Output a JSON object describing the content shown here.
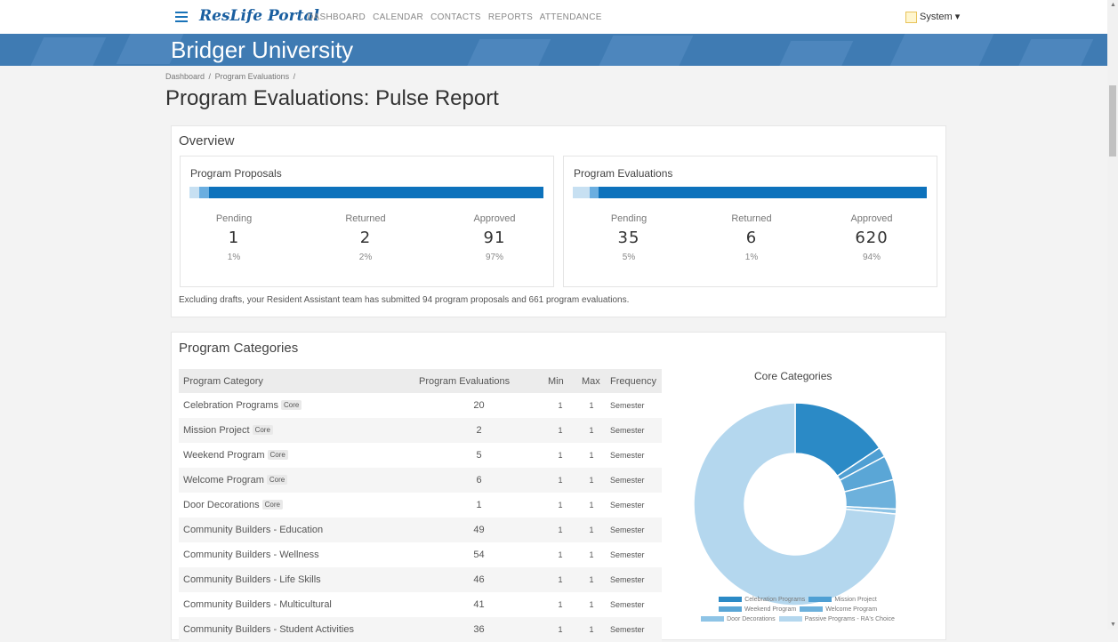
{
  "app": {
    "logo": "ResLife Portal",
    "nav": [
      "DASHBOARD",
      "CALENDAR",
      "CONTACTS",
      "REPORTS",
      "ATTENDANCE"
    ],
    "user": "System ▾",
    "banner_title": "Bridger University"
  },
  "breadcrumb": [
    "Dashboard",
    "/",
    "Program Evaluations",
    "/"
  ],
  "page_title": "Program Evaluations: Pulse Report",
  "overview": {
    "title": "Overview",
    "proposals": {
      "title": "Program Proposals",
      "stats": [
        {
          "label": "Pending",
          "value": "1",
          "pct": "1%",
          "fraction": 0.01
        },
        {
          "label": "Returned",
          "value": "2",
          "pct": "2%",
          "fraction": 0.02
        },
        {
          "label": "Approved",
          "value": "91",
          "pct": "97%",
          "fraction": 0.97
        }
      ]
    },
    "evaluations": {
      "title": "Program Evaluations",
      "stats": [
        {
          "label": "Pending",
          "value": "35",
          "pct": "5%",
          "fraction": 0.05
        },
        {
          "label": "Returned",
          "value": "6",
          "pct": "1%",
          "fraction": 0.01
        },
        {
          "label": "Approved",
          "value": "620",
          "pct": "94%",
          "fraction": 0.94
        }
      ]
    },
    "summary": "Excluding drafts, your Resident Assistant team has submitted 94 program proposals and 661 program evaluations."
  },
  "categories": {
    "title": "Program Categories",
    "columns": [
      "Program Category",
      "Program Evaluations",
      "Min",
      "Max",
      "Frequency"
    ],
    "badge": "Core",
    "rows": [
      {
        "name": "Celebration Programs",
        "core": true,
        "evals": "20",
        "min": "1",
        "max": "1",
        "freq": "Semester"
      },
      {
        "name": "Mission Project",
        "core": true,
        "evals": "2",
        "min": "1",
        "max": "1",
        "freq": "Semester"
      },
      {
        "name": "Weekend Program",
        "core": true,
        "evals": "5",
        "min": "1",
        "max": "1",
        "freq": "Semester"
      },
      {
        "name": "Welcome Program",
        "core": true,
        "evals": "6",
        "min": "1",
        "max": "1",
        "freq": "Semester"
      },
      {
        "name": "Door Decorations",
        "core": true,
        "evals": "1",
        "min": "1",
        "max": "1",
        "freq": "Semester"
      },
      {
        "name": "Community Builders - Education",
        "core": false,
        "evals": "49",
        "min": "1",
        "max": "1",
        "freq": "Semester"
      },
      {
        "name": "Community Builders - Wellness",
        "core": false,
        "evals": "54",
        "min": "1",
        "max": "1",
        "freq": "Semester"
      },
      {
        "name": "Community Builders - Life Skills",
        "core": false,
        "evals": "46",
        "min": "1",
        "max": "1",
        "freq": "Semester"
      },
      {
        "name": "Community Builders - Multicultural",
        "core": false,
        "evals": "41",
        "min": "1",
        "max": "1",
        "freq": "Semester"
      },
      {
        "name": "Community Builders - Student Activities",
        "core": false,
        "evals": "36",
        "min": "1",
        "max": "1",
        "freq": "Semester"
      }
    ]
  },
  "chart_data": {
    "type": "pie",
    "title": "Core Categories",
    "categories": [
      "Celebration Programs",
      "Mission Project",
      "Weekend Program",
      "Welcome Program",
      "Door Decorations",
      "Passive Programs - RA's Choice"
    ],
    "values": [
      20,
      2,
      5,
      6,
      1,
      94
    ],
    "colors": [
      "#2b8ac6",
      "#4f9fd3",
      "#5aa6d6",
      "#6db1dc",
      "#8ec4e6",
      "#b4d7ee"
    ],
    "legend_position": "bottom"
  },
  "colors": {
    "bar_pending": "#c7e0f2",
    "bar_returned": "#6aaee0",
    "bar_approved": "#0d72bc"
  }
}
